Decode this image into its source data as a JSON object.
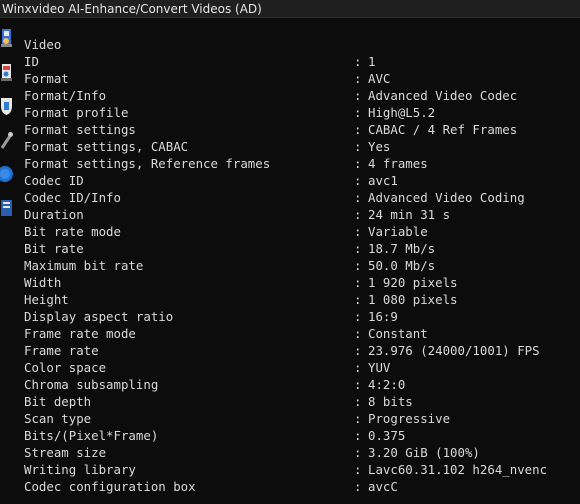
{
  "window": {
    "title": "Winxvideo AI-Enhance/Convert Videos (AD)"
  },
  "dock": {
    "icons": [
      "wizard-tool-icon",
      "wizard-convert-icon",
      "shield-icon",
      "wrench-icon",
      "globe-icon",
      "book-icon"
    ]
  },
  "mediainfo": {
    "section": "Video",
    "separator": ":",
    "rows": [
      {
        "key": "ID",
        "value": "1"
      },
      {
        "key": "Format",
        "value": "AVC"
      },
      {
        "key": "Format/Info",
        "value": "Advanced Video Codec"
      },
      {
        "key": "Format profile",
        "value": "High@L5.2"
      },
      {
        "key": "Format settings",
        "value": "CABAC / 4 Ref Frames"
      },
      {
        "key": "Format settings, CABAC",
        "value": "Yes"
      },
      {
        "key": "Format settings, Reference frames",
        "value": "4 frames"
      },
      {
        "key": "Codec ID",
        "value": "avc1"
      },
      {
        "key": "Codec ID/Info",
        "value": "Advanced Video Coding"
      },
      {
        "key": "Duration",
        "value": "24 min 31 s"
      },
      {
        "key": "Bit rate mode",
        "value": "Variable"
      },
      {
        "key": "Bit rate",
        "value": "18.7 Mb/s"
      },
      {
        "key": "Maximum bit rate",
        "value": "50.0 Mb/s"
      },
      {
        "key": "Width",
        "value": "1 920 pixels"
      },
      {
        "key": "Height",
        "value": "1 080 pixels"
      },
      {
        "key": "Display aspect ratio",
        "value": "16:9"
      },
      {
        "key": "Frame rate mode",
        "value": "Constant"
      },
      {
        "key": "Frame rate",
        "value": "23.976 (24000/1001) FPS"
      },
      {
        "key": "Color space",
        "value": "YUV"
      },
      {
        "key": "Chroma subsampling",
        "value": "4:2:0"
      },
      {
        "key": "Bit depth",
        "value": "8 bits"
      },
      {
        "key": "Scan type",
        "value": "Progressive"
      },
      {
        "key": "Bits/(Pixel*Frame)",
        "value": "0.375"
      },
      {
        "key": "Stream size",
        "value": "3.20 GiB (100%)"
      },
      {
        "key": "Writing library",
        "value": "Lavc60.31.102 h264_nvenc"
      },
      {
        "key": "Codec configuration box",
        "value": "avcC"
      }
    ]
  }
}
